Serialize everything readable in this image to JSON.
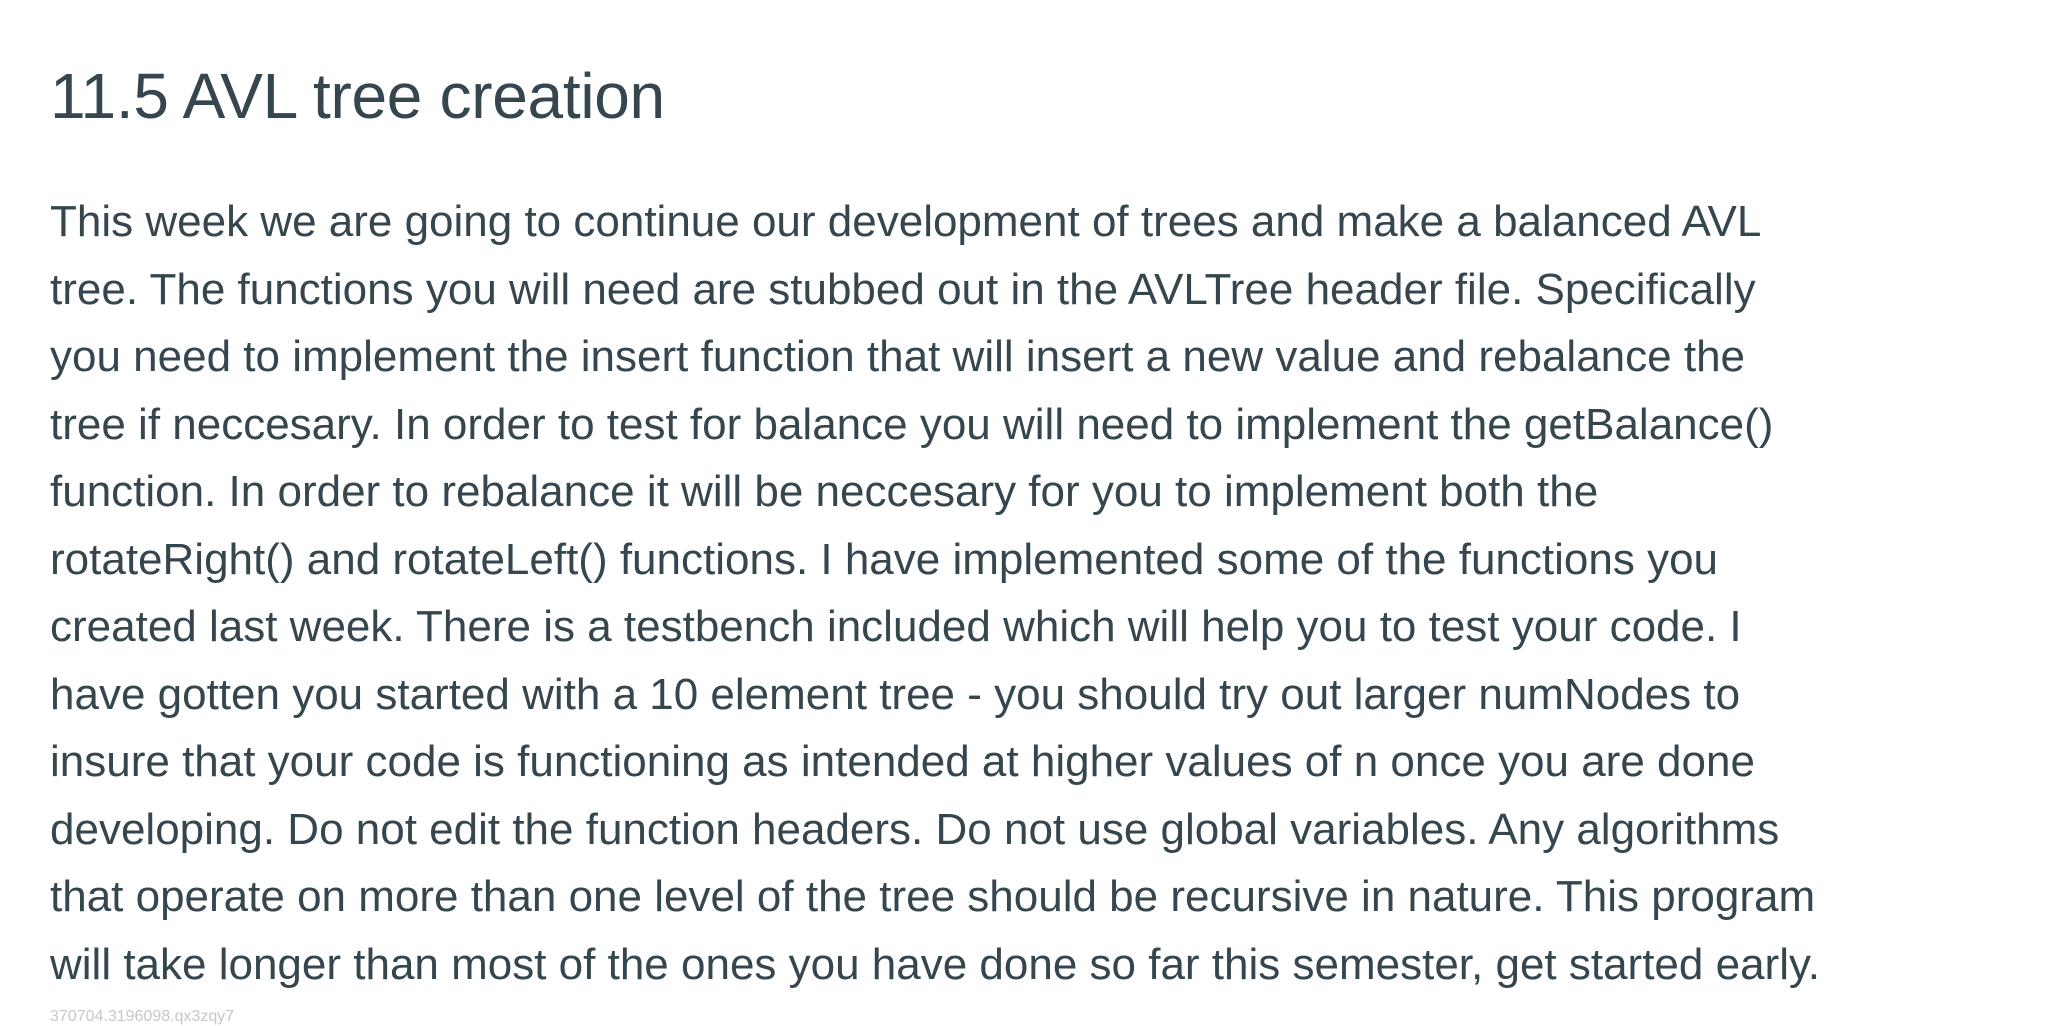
{
  "heading": "11.5 AVL tree creation",
  "paragraph_lines": [
    "This week we are going to continue our development of trees and make a balanced AVL",
    "tree. The functions you will need are stubbed out in the AVLTree header file. Specifically",
    "you need to implement the insert function that will insert a new value and rebalance the",
    "tree if neccesary. In order to test for balance you will need to implement the getBalance()",
    "function. In order to rebalance it will be neccesary for you to implement both the",
    "rotateRight() and rotateLeft() functions. I have implemented some of the functions you",
    "created last week. There is a testbench included which will help you to test your code. I",
    "have gotten you started with a 10 element tree - you should try out larger numNodes to",
    "insure that your code is functioning as intended at higher values of n once you are done",
    "developing. Do not edit the function headers. Do not use global variables. Any algorithms",
    "that operate on more than one level of the tree should be recursive in nature. This program",
    "will take longer than most of the ones you have done so far this semester, get started early."
  ],
  "footer_id": "370704.3196098.qx3zqy7"
}
